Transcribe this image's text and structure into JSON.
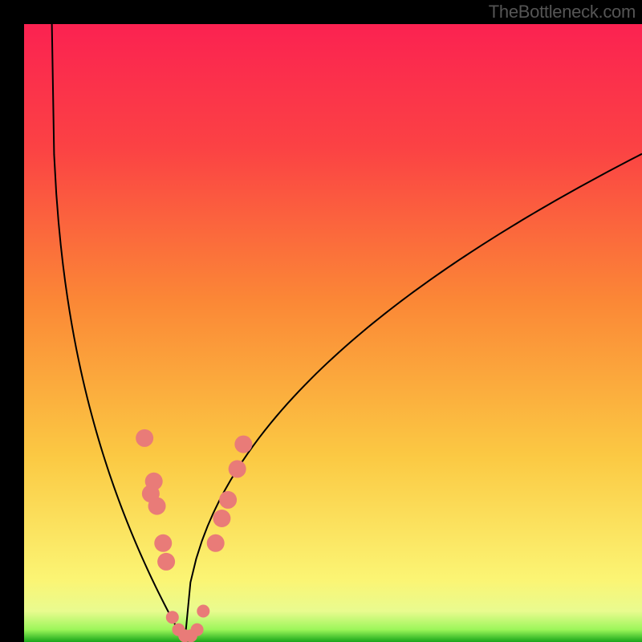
{
  "watermark": "TheBottleneck.com",
  "chart_data": {
    "type": "line",
    "title": "",
    "xlabel": "",
    "ylabel": "",
    "xlim": [
      0,
      100
    ],
    "ylim": [
      0,
      100
    ],
    "background_gradient": {
      "stops": [
        {
          "offset": 0,
          "color": "#17a61a"
        },
        {
          "offset": 2,
          "color": "#9cf65a"
        },
        {
          "offset": 5,
          "color": "#e9fb8f"
        },
        {
          "offset": 10,
          "color": "#fbf574"
        },
        {
          "offset": 30,
          "color": "#fbc943"
        },
        {
          "offset": 55,
          "color": "#fb8836"
        },
        {
          "offset": 80,
          "color": "#fb4244"
        },
        {
          "offset": 100,
          "color": "#fb2251"
        }
      ]
    },
    "curve": {
      "description": "V-shaped bottleneck curve, asymmetric",
      "minimum_x": 26,
      "minimum_y": 0,
      "left_endpoint": {
        "x": 4.5,
        "y": 100
      },
      "right_endpoint": {
        "x": 100,
        "y": 79
      },
      "color": "#000000",
      "stroke_width": 2
    },
    "markers": {
      "color": "#e97b78",
      "radius_large": 11,
      "radius_linker": 8,
      "arm_y_max_pct": 33,
      "points_left_arm": [
        {
          "x": 19.5,
          "y": 33
        },
        {
          "x": 21,
          "y": 26
        },
        {
          "x": 20.5,
          "y": 24
        },
        {
          "x": 21.5,
          "y": 22
        },
        {
          "x": 22.5,
          "y": 16
        },
        {
          "x": 23,
          "y": 13
        }
      ],
      "points_right_arm": [
        {
          "x": 31,
          "y": 16
        },
        {
          "x": 32,
          "y": 20
        },
        {
          "x": 33,
          "y": 23
        },
        {
          "x": 34.5,
          "y": 28
        },
        {
          "x": 35.5,
          "y": 32
        }
      ],
      "bottom_linkers": [
        {
          "x": 24,
          "y": 4
        },
        {
          "x": 25,
          "y": 2
        },
        {
          "x": 26,
          "y": 1
        },
        {
          "x": 27,
          "y": 1
        },
        {
          "x": 28,
          "y": 2
        },
        {
          "x": 29,
          "y": 5
        }
      ]
    }
  }
}
